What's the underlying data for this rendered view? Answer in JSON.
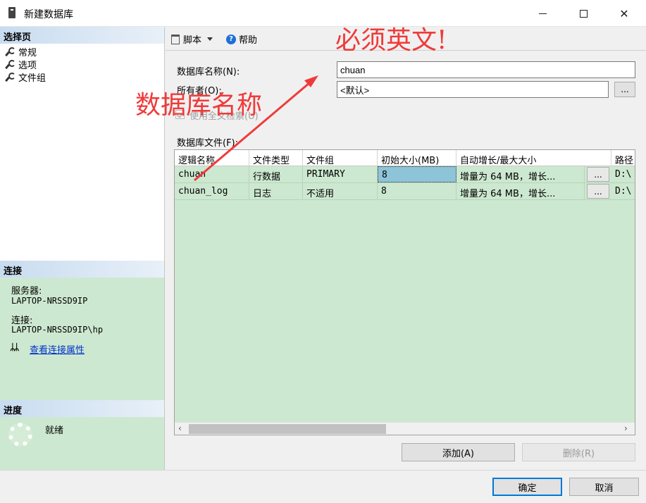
{
  "window": {
    "title": "新建数据库"
  },
  "left": {
    "select_page_header": "选择页",
    "nav_items": [
      "常规",
      "选项",
      "文件组"
    ],
    "connection_header": "连接",
    "server_label": "服务器:",
    "server_value": "LAPTOP-NRSSD9IP",
    "conn_label": "连接:",
    "conn_value": "LAPTOP-NRSSD9IP\\hp",
    "view_props_link": "查看连接属性",
    "progress_header": "进度",
    "progress_status": "就绪"
  },
  "toolbar": {
    "script_label": "脚本",
    "help_label": "帮助"
  },
  "form": {
    "db_name_label": "数据库名称(N):",
    "db_name_value": "chuan",
    "owner_label": "所有者(O):",
    "owner_value": "<默认>",
    "owner_browse": "...",
    "fulltext_label": "使用全文检索(U)",
    "db_files_label": "数据库文件(F):"
  },
  "grid": {
    "columns": [
      "逻辑名称",
      "文件类型",
      "文件组",
      "初始大小(MB)",
      "自动增长/最大大小",
      "路径"
    ],
    "rows": [
      {
        "logical": "chuan",
        "type": "行数据",
        "group": "PRIMARY",
        "size": "8",
        "growth": "增量为 64 MB，增长...",
        "browse": "...",
        "path": "D:\\"
      },
      {
        "logical": "chuan_log",
        "type": "日志",
        "group": "不适用",
        "size": "8",
        "growth": "增量为 64 MB，增长...",
        "browse": "...",
        "path": "D:\\"
      }
    ]
  },
  "buttons": {
    "add": "添加(A)",
    "remove": "删除(R)",
    "ok": "确定",
    "cancel": "取消"
  },
  "annotations": {
    "top": "必须英文!",
    "left": "数据库名称"
  },
  "colors": {
    "annotation": "#f03a3a",
    "panel_green": "#cde8d0",
    "selected_cell": "#8ec4d8"
  }
}
